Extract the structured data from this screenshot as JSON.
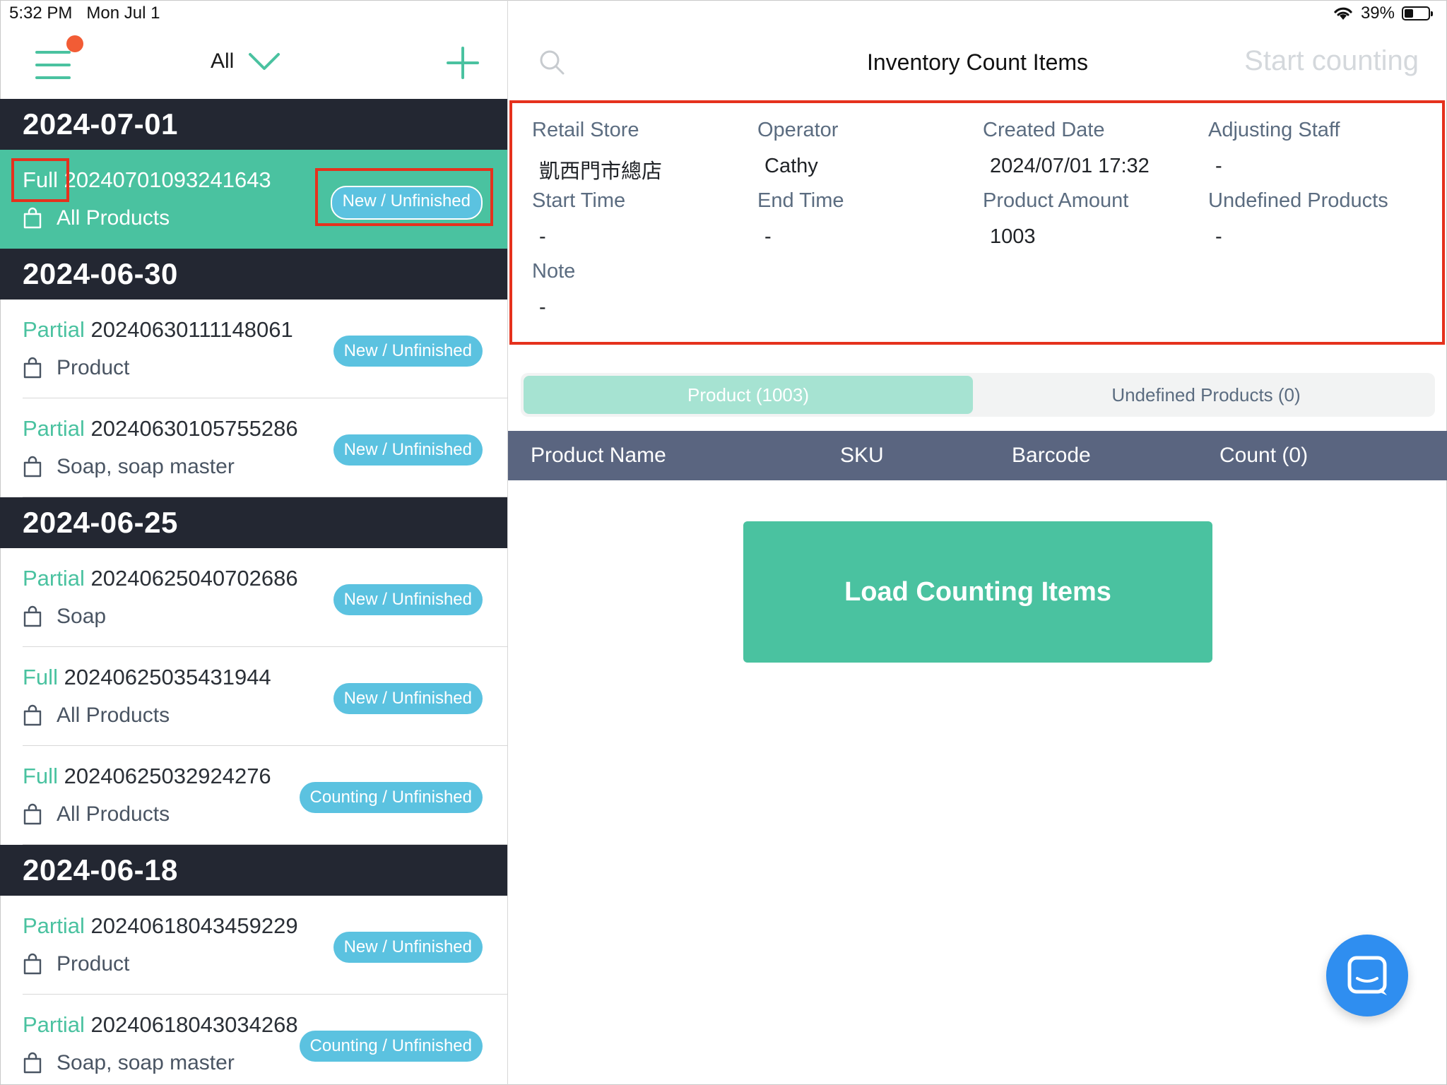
{
  "status_bar": {
    "time": "5:32 PM",
    "date": "Mon Jul 1",
    "battery": "39%",
    "battery_level": 0.39
  },
  "left_header": {
    "filter_label": "All",
    "icons": [
      "menu-icon",
      "chevron-down-icon",
      "plus-icon"
    ]
  },
  "groups": [
    {
      "date": "2024-07-01",
      "items": [
        {
          "type": "Full",
          "id": "20240701093241643",
          "scope": "All Products",
          "status": "New / Unfinished",
          "selected": true
        }
      ]
    },
    {
      "date": "2024-06-30",
      "items": [
        {
          "type": "Partial",
          "id": "20240630111148061",
          "scope": "Product",
          "status": "New / Unfinished"
        },
        {
          "type": "Partial",
          "id": "20240630105755286",
          "scope": "Soap, soap master",
          "status": "New / Unfinished"
        }
      ]
    },
    {
      "date": "2024-06-25",
      "items": [
        {
          "type": "Partial",
          "id": "20240625040702686",
          "scope": "Soap",
          "status": "New / Unfinished"
        },
        {
          "type": "Full",
          "id": "20240625035431944",
          "scope": "All Products",
          "status": "New / Unfinished"
        },
        {
          "type": "Full",
          "id": "20240625032924276",
          "scope": "All Products",
          "status": "Counting / Unfinished"
        }
      ]
    },
    {
      "date": "2024-06-18",
      "items": [
        {
          "type": "Partial",
          "id": "20240618043459229",
          "scope": "Product",
          "status": "New / Unfinished"
        },
        {
          "type": "Partial",
          "id": "20240618043034268",
          "scope": "Soap, soap master",
          "status": "Counting / Unfinished"
        }
      ]
    }
  ],
  "right_header": {
    "title": "Inventory Count Items",
    "start_label": "Start counting"
  },
  "info": {
    "retail_store_label": "Retail Store",
    "retail_store_value": "凱西門市總店",
    "operator_label": "Operator",
    "operator_value": "Cathy",
    "created_label": "Created Date",
    "created_value": "2024/07/01 17:32",
    "adjusting_label": "Adjusting Staff",
    "adjusting_value": "-",
    "start_time_label": "Start Time",
    "start_time_value": "-",
    "end_time_label": "End Time",
    "end_time_value": "-",
    "product_amount_label": "Product Amount",
    "product_amount_value": "1003",
    "undefined_label": "Undefined Products",
    "undefined_value": "-",
    "note_label": "Note",
    "note_value": "-"
  },
  "tabs": {
    "product": "Product (1003)",
    "undefined": "Undefined Products (0)"
  },
  "table_header": {
    "name": "Product Name",
    "sku": "SKU",
    "barcode": "Barcode",
    "count": "Count (0)"
  },
  "load_button": "Load Counting Items",
  "colors": {
    "accent": "#4ac2a0",
    "badge": "#5bc2e0",
    "header_dark": "#232732",
    "table_header": "#5a6580",
    "annotation": "#e5311d",
    "notification_dot": "#f25c35",
    "chat": "#2f8ef0"
  }
}
